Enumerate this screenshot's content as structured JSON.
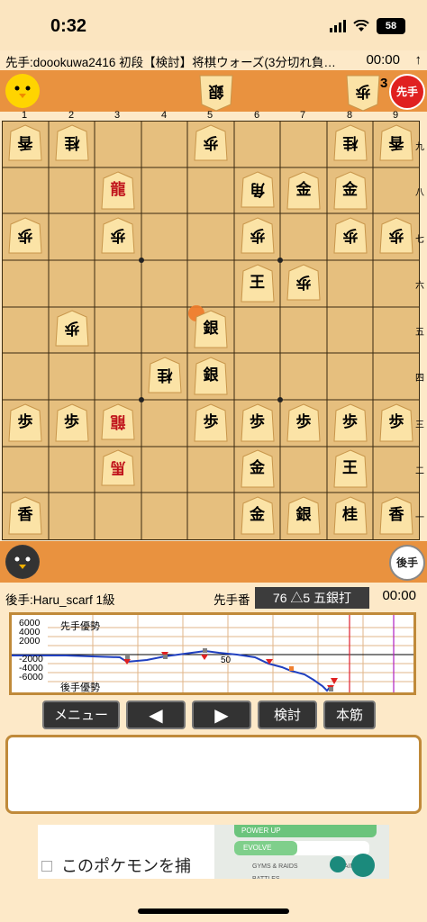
{
  "status_bar": {
    "time": "0:32",
    "battery": "58"
  },
  "header": {
    "title": "先手:doookuwa2416 初段【検討】将棋ウォーズ(3分切れ負…",
    "timer": "00:00",
    "share_icon": "arrow-up-icon"
  },
  "top_hand": {
    "pieces": [
      "銀",
      "歩"
    ],
    "pawn_count": "3",
    "turn_label": "先手"
  },
  "bottom_hand": {
    "turn_label": "後手"
  },
  "board": {
    "files": [
      "1",
      "2",
      "3",
      "4",
      "5",
      "6",
      "7",
      "8",
      "9"
    ],
    "ranks": [
      "九",
      "八",
      "七",
      "六",
      "五",
      "四",
      "三",
      "二",
      "一"
    ],
    "last_move_marker_color": "#f07a2a",
    "pieces": [
      {
        "file": 0,
        "rank": 0,
        "kind": "香",
        "inv": true
      },
      {
        "file": 1,
        "rank": 0,
        "kind": "桂",
        "inv": true
      },
      {
        "file": 4,
        "rank": 0,
        "kind": "歩",
        "inv": true
      },
      {
        "file": 7,
        "rank": 0,
        "kind": "桂",
        "inv": true
      },
      {
        "file": 8,
        "rank": 0,
        "kind": "香",
        "inv": true
      },
      {
        "file": 2,
        "rank": 1,
        "kind": "龍",
        "inv": false,
        "red": true
      },
      {
        "file": 5,
        "rank": 1,
        "kind": "角",
        "inv": true
      },
      {
        "file": 6,
        "rank": 1,
        "kind": "金",
        "inv": false
      },
      {
        "file": 7,
        "rank": 1,
        "kind": "金",
        "inv": false
      },
      {
        "file": 0,
        "rank": 2,
        "kind": "歩",
        "inv": true
      },
      {
        "file": 2,
        "rank": 2,
        "kind": "歩",
        "inv": true
      },
      {
        "file": 5,
        "rank": 2,
        "kind": "歩",
        "inv": true
      },
      {
        "file": 7,
        "rank": 2,
        "kind": "歩",
        "inv": true
      },
      {
        "file": 8,
        "rank": 2,
        "kind": "歩",
        "inv": true
      },
      {
        "file": 5,
        "rank": 3,
        "kind": "王",
        "inv": false
      },
      {
        "file": 6,
        "rank": 3,
        "kind": "歩",
        "inv": true
      },
      {
        "file": 1,
        "rank": 4,
        "kind": "歩",
        "inv": true
      },
      {
        "file": 4,
        "rank": 4,
        "kind": "銀",
        "inv": false
      },
      {
        "file": 3,
        "rank": 5,
        "kind": "桂",
        "inv": true
      },
      {
        "file": 4,
        "rank": 5,
        "kind": "銀",
        "inv": false
      },
      {
        "file": 0,
        "rank": 6,
        "kind": "歩",
        "inv": false
      },
      {
        "file": 1,
        "rank": 6,
        "kind": "歩",
        "inv": false
      },
      {
        "file": 2,
        "rank": 6,
        "kind": "龍",
        "inv": true,
        "red": true
      },
      {
        "file": 4,
        "rank": 6,
        "kind": "歩",
        "inv": false
      },
      {
        "file": 5,
        "rank": 6,
        "kind": "歩",
        "inv": false
      },
      {
        "file": 6,
        "rank": 6,
        "kind": "歩",
        "inv": false
      },
      {
        "file": 7,
        "rank": 6,
        "kind": "歩",
        "inv": false
      },
      {
        "file": 8,
        "rank": 6,
        "kind": "歩",
        "inv": false
      },
      {
        "file": 2,
        "rank": 7,
        "kind": "馬",
        "inv": true,
        "red": true
      },
      {
        "file": 5,
        "rank": 7,
        "kind": "金",
        "inv": false
      },
      {
        "file": 7,
        "rank": 7,
        "kind": "王",
        "inv": false
      },
      {
        "file": 0,
        "rank": 8,
        "kind": "香",
        "inv": false
      },
      {
        "file": 5,
        "rank": 8,
        "kind": "金",
        "inv": false
      },
      {
        "file": 6,
        "rank": 8,
        "kind": "銀",
        "inv": false
      },
      {
        "file": 7,
        "rank": 8,
        "kind": "桂",
        "inv": false
      },
      {
        "file": 8,
        "rank": 8,
        "kind": "香",
        "inv": false
      }
    ]
  },
  "info": {
    "gote_player": "後手:Haru_scarf 1級",
    "turn": "先手番",
    "last_move": "76 △5 五銀打",
    "timer": "00:00"
  },
  "graph": {
    "y_ticks": [
      "6000",
      "4000",
      "2000",
      "-2000",
      "-4000",
      "-6000"
    ],
    "sente_label": "先手優勢",
    "gote_label": "後手優勢",
    "mid_label": "50"
  },
  "buttons": {
    "menu": "メニュー",
    "prev": "◀",
    "next": "▶",
    "analyze": "検討",
    "main_line": "本筋"
  },
  "ad": {
    "text": "このポケモンを捕",
    "items": [
      "POWER UP",
      "EVOLVE",
      "GYMS & RAIDS",
      "TRAINER BATTLES"
    ]
  }
}
